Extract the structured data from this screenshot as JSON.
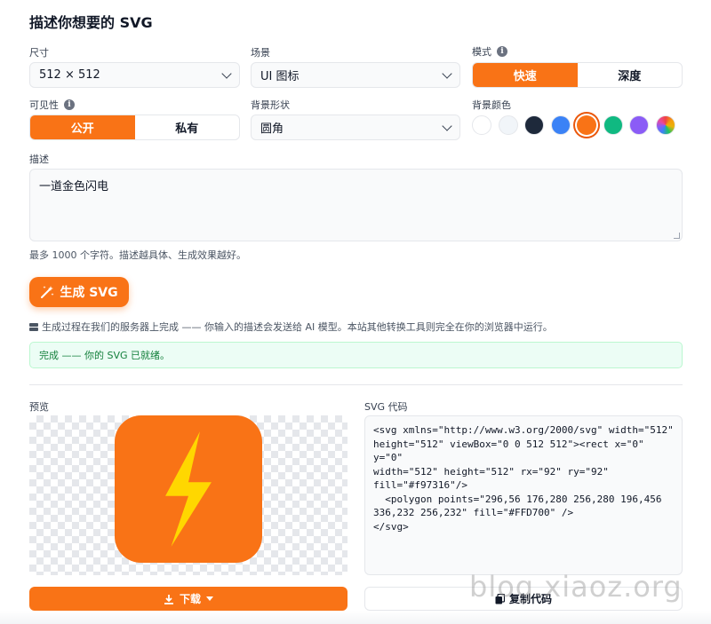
{
  "title": "描述你想要的 SVG",
  "size": {
    "label": "尺寸",
    "value": "512 × 512"
  },
  "scene": {
    "label": "场景",
    "value": "UI 图标"
  },
  "mode": {
    "label": "模式",
    "options": [
      "快速",
      "深度"
    ],
    "selected": "快速"
  },
  "visibility": {
    "label": "可见性",
    "options": [
      "公开",
      "私有"
    ],
    "selected": "公开"
  },
  "bg_shape": {
    "label": "背景形状",
    "value": "圆角"
  },
  "bg_color": {
    "label": "背景颜色",
    "swatches": [
      "#ffffff",
      "#f1f5f9",
      "#1e293b",
      "#3b82f6",
      "#f97316",
      "#10b981",
      "#8b5cf6",
      "rainbow"
    ],
    "selected": "#f97316"
  },
  "description": {
    "label": "描述",
    "value": "一道金色闪电",
    "hint": "最多 1000 个字符。描述越具体、生成效果越好。"
  },
  "generate_button": "生成 SVG",
  "server_note": "生成过程在我们的服务器上完成 —— 你输入的描述会发送给 AI 模型。本站其他转换工具则完全在你的浏览器中运行。",
  "status": "完成 —— 你的 SVG 已就绪。",
  "preview": {
    "label": "预览",
    "rect_fill": "#f97316",
    "bolt_fill": "#FFD700"
  },
  "code": {
    "label": "SVG 代码",
    "text": "<svg xmlns=\"http://www.w3.org/2000/svg\" width=\"512\"\nheight=\"512\" viewBox=\"0 0 512 512\"><rect x=\"0\" y=\"0\"\nwidth=\"512\" height=\"512\" rx=\"92\" ry=\"92\"\nfill=\"#f97316\"/>\n  <polygon points=\"296,56 176,280 256,280 196,456\n336,232 256,232\" fill=\"#FFD700\" />\n</svg>"
  },
  "download_button": "下载",
  "copy_button": "复制代码",
  "watermark": "blog.xiaoz.org",
  "colors": {
    "accent": "#f97316",
    "success_text": "#15803d",
    "success_bg": "#ecfdf5"
  },
  "icons": [
    "info-icon",
    "chevron-down-icon",
    "magic-wand-icon",
    "server-icon",
    "download-icon",
    "caret-down-icon",
    "copy-icon"
  ]
}
